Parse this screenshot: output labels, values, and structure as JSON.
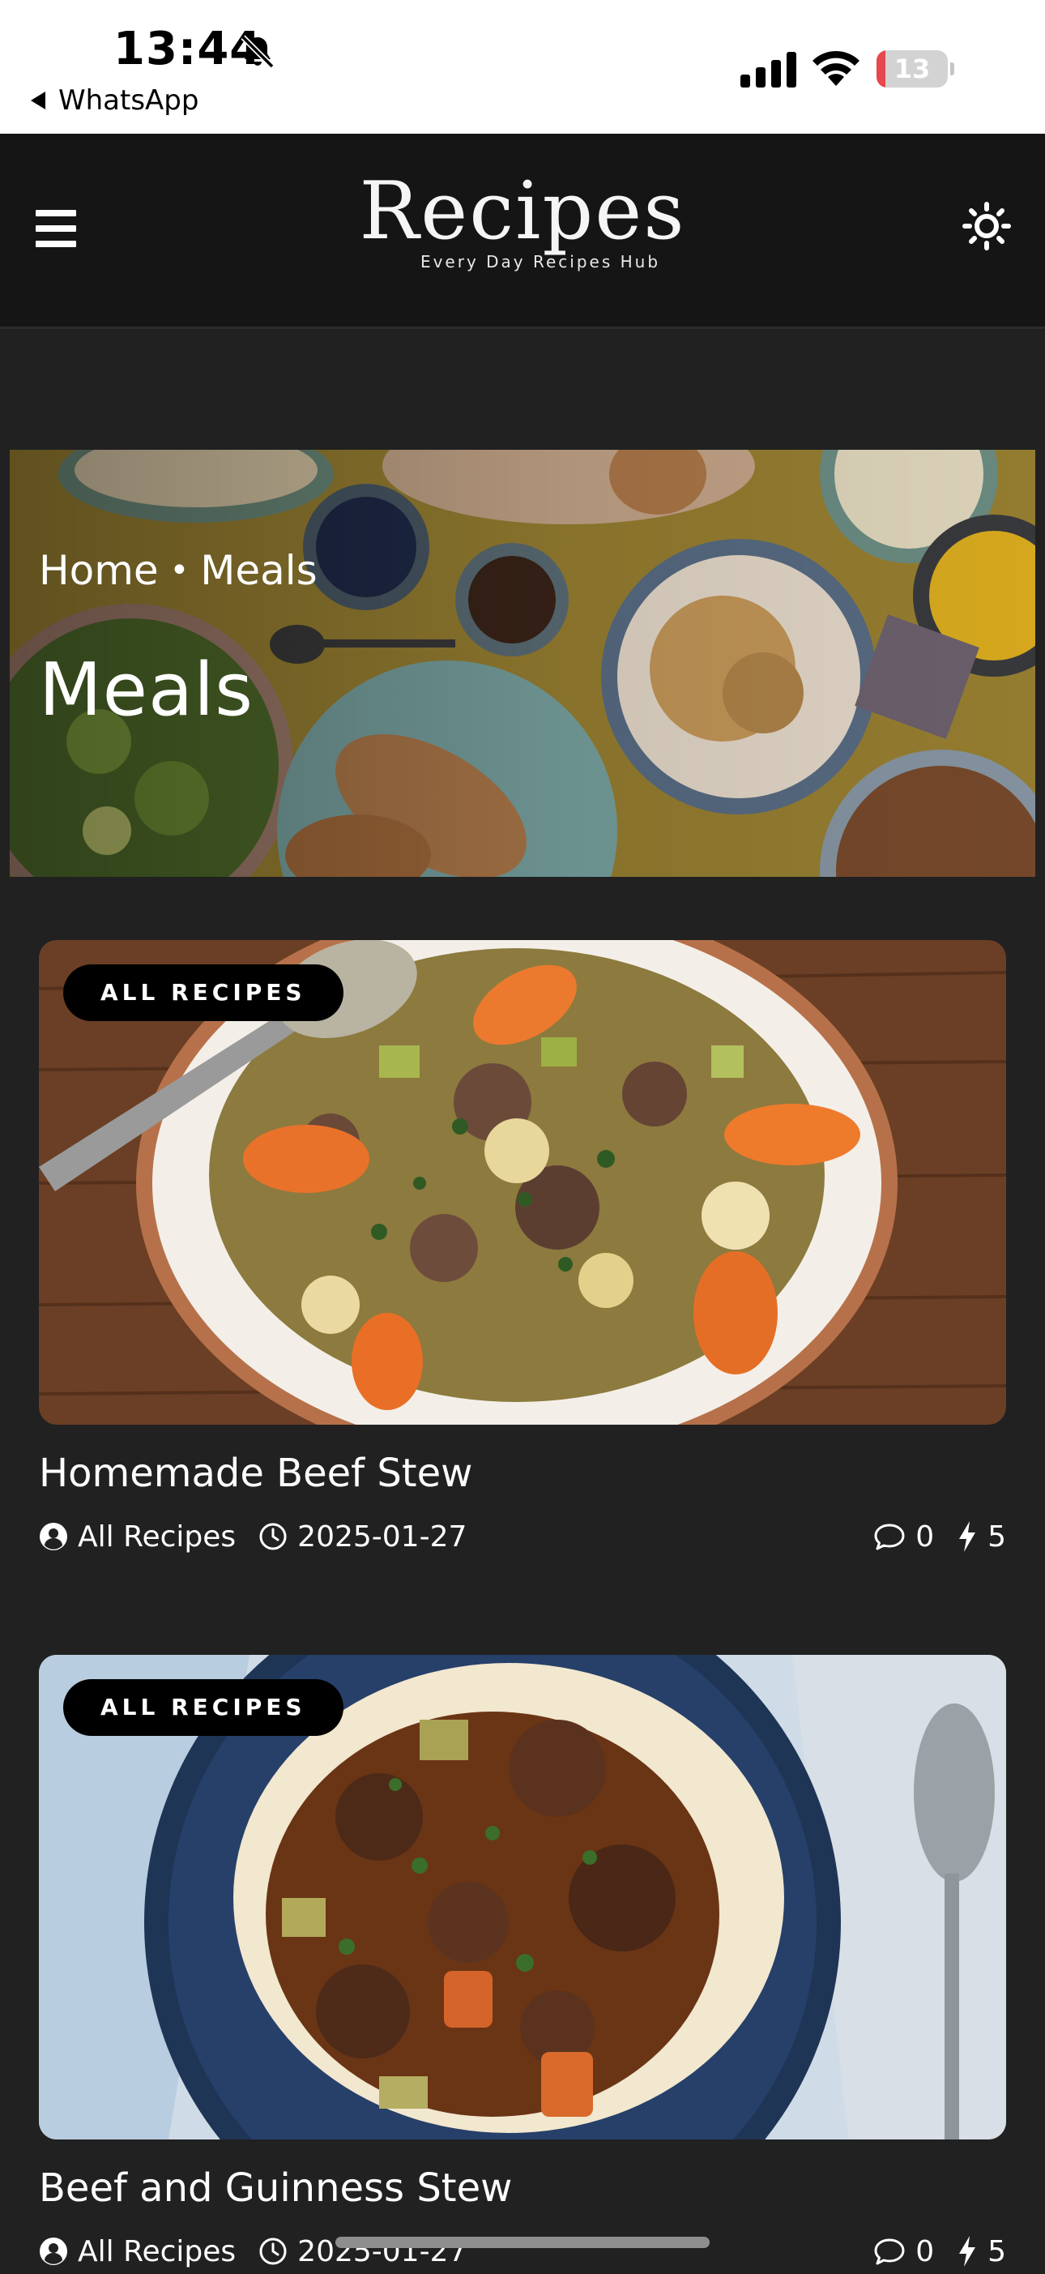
{
  "status_bar": {
    "time": "13:44",
    "back_app": "WhatsApp",
    "battery_level": "13",
    "battery_fraction": 0.13,
    "icons": [
      "bell-slash-icon",
      "signal-icon",
      "wifi-icon",
      "battery-icon"
    ]
  },
  "header": {
    "logo_word": "Recipes",
    "logo_tagline": "Every Day Recipes Hub",
    "menu_icon": "hamburger-menu-icon",
    "theme_icon": "sun-icon"
  },
  "hero": {
    "breadcrumb": {
      "home": "Home",
      "separator": "•",
      "current": "Meals"
    },
    "title": "Meals"
  },
  "recipes": [
    {
      "badge": "ALL RECIPES",
      "title": "Homemade Beef Stew",
      "author": "All Recipes",
      "date": "2025-01-27",
      "comments": "0",
      "score": "5"
    },
    {
      "badge": "ALL RECIPES",
      "title": "Beef and Guinness Stew",
      "author": "All Recipes",
      "date": "2025-01-27",
      "comments": "0",
      "score": "5"
    }
  ],
  "colors": {
    "page_bg": "#212121",
    "header_bg": "#151515",
    "badge_bg": "#000000",
    "text": "#ffffff",
    "battery_low": "#e5484d"
  }
}
